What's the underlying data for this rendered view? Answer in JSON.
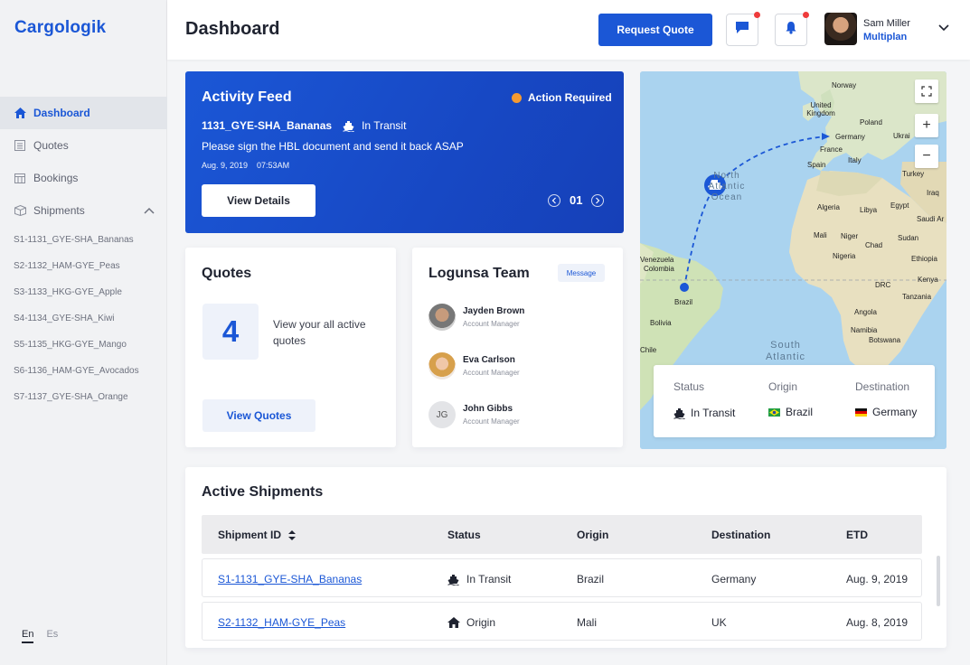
{
  "sidebar": {
    "logo": "Cargologik",
    "nav": [
      {
        "label": "Dashboard",
        "icon": "home-icon"
      },
      {
        "label": "Quotes",
        "icon": "list-icon"
      },
      {
        "label": "Bookings",
        "icon": "calendar-icon"
      },
      {
        "label": "Shipments",
        "icon": "box-icon"
      }
    ],
    "shipments": [
      "S1-1131_GYE-SHA_Bananas",
      "S2-1132_HAM-GYE_Peas",
      "S3-1133_HKG-GYE_Apple",
      "S4-1134_GYE-SHA_Kiwi",
      "S5-1135_HKG-GYE_Mango",
      "S6-1136_HAM-GYE_Avocados",
      "S7-1137_GYE-SHA_Orange"
    ],
    "languages": [
      "En",
      "Es"
    ]
  },
  "header": {
    "title": "Dashboard",
    "request_quote": "Request Quote",
    "user_name": "Sam Miller",
    "user_org": "Multiplan"
  },
  "activity": {
    "title": "Activity Feed",
    "flag": "Action Required",
    "shipment": "1131_GYE-SHA_Bananas",
    "status": "In Transit",
    "message": "Please sign the HBL document and send it back ASAP",
    "date": "Aug. 9, 2019    07:53AM",
    "button": "View Details",
    "page": "01"
  },
  "quotes": {
    "title": "Quotes",
    "count": "4",
    "desc": "View your all active quotes",
    "button": "View Quotes"
  },
  "team": {
    "title": "Logunsa Team",
    "message": "Message",
    "members": [
      {
        "name": "Jayden Brown",
        "role": "Account Manager",
        "initials": ""
      },
      {
        "name": "Eva Carlson",
        "role": "Account Manager",
        "initials": ""
      },
      {
        "name": "John Gibbs",
        "role": "Account Manager",
        "initials": "JG"
      }
    ]
  },
  "map": {
    "labels": [
      "Norway",
      "United Kingdom",
      "Poland",
      "Germany",
      "Ukrai",
      "France",
      "Spain",
      "Italy",
      "Turkey",
      "Iraq",
      "Algeria",
      "Libya",
      "Egypt",
      "Saudi Ar",
      "Mali",
      "Niger",
      "Chad",
      "Sudan",
      "Nigeria",
      "Ethiopia",
      "Kenya",
      "Venezuela",
      "Colombia",
      "DRC",
      "Tanzania",
      "Brazil",
      "Bolivia",
      "Angola",
      "Namibia",
      "Botswana",
      "Chile",
      "North Atlantic Ocean",
      "South Atlantic"
    ],
    "status_label": "Status",
    "origin_label": "Origin",
    "destination_label": "Destination",
    "status": "In Transit",
    "origin": "Brazil",
    "destination": "Germany"
  },
  "shipments": {
    "title": "Active Shipments",
    "columns": [
      "Shipment ID",
      "Status",
      "Origin",
      "Destination",
      "ETD"
    ],
    "rows": [
      {
        "id": "S1-1131_GYE-SHA_Bananas",
        "status": "In Transit",
        "origin": "Brazil",
        "destination": "Germany",
        "etd": "Aug. 9, 2019"
      },
      {
        "id": "S2-1132_HAM-GYE_Peas",
        "status": "Origin",
        "origin": "Mali",
        "destination": "UK",
        "etd": "Aug. 8, 2019"
      }
    ]
  }
}
